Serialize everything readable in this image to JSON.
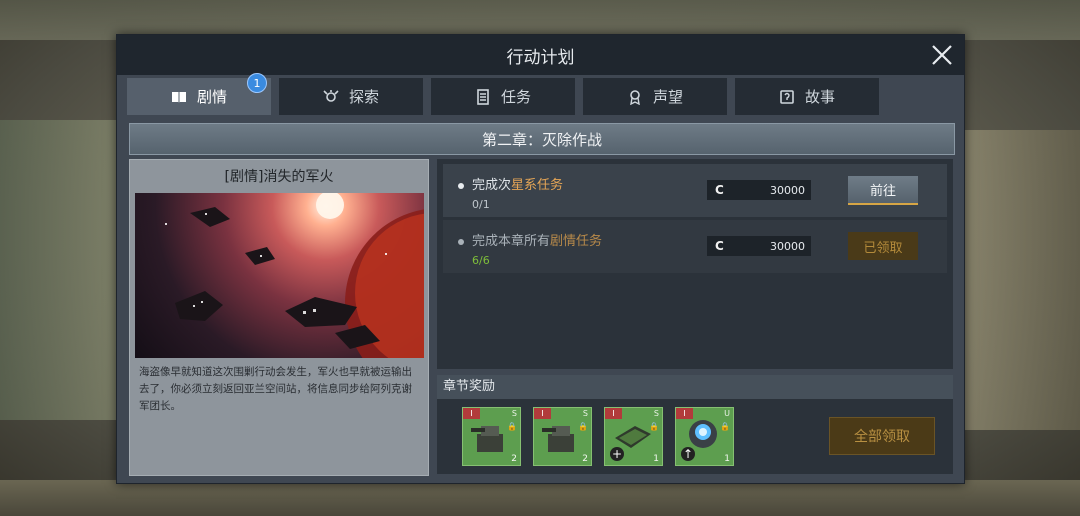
{
  "window": {
    "title": "行动计划"
  },
  "tabs": [
    {
      "label": "剧情",
      "icon": "book-icon",
      "active": true,
      "badge": "1"
    },
    {
      "label": "探索",
      "icon": "explore-icon",
      "active": false
    },
    {
      "label": "任务",
      "icon": "task-list-icon",
      "active": false
    },
    {
      "label": "声望",
      "icon": "medal-icon",
      "active": false
    },
    {
      "label": "故事",
      "icon": "story-icon",
      "active": false
    }
  ],
  "chapter": {
    "title": "第二章：灭除作战"
  },
  "story": {
    "title": "[剧情]消失的军火",
    "description": "海盗像早就知道这次围剿行动会发生，军火也早就被运输出去了，你必须立刻返回亚兰空间站，将信息同步给阿列克谢军团长。"
  },
  "tasks": [
    {
      "prefix": "完成",
      "middle": "次",
      "highlight": "星系任务",
      "progress": "0/1",
      "currency_icon": "C",
      "reward": "30000",
      "button": "前往"
    },
    {
      "prefix": "完成本章所有",
      "middle": "",
      "highlight": "剧情任务",
      "progress": "6/6",
      "currency_icon": "C",
      "reward": "30000",
      "button": "已领取"
    }
  ],
  "chapter_rewards": {
    "heading": "章节奖励",
    "items": [
      {
        "tag": "I",
        "grade": "S",
        "qty": "2",
        "icon": "turret-module-icon"
      },
      {
        "tag": "I",
        "grade": "S",
        "qty": "2",
        "icon": "turret-module-icon"
      },
      {
        "tag": "I",
        "grade": "S",
        "qty": "1",
        "icon": "circuit-board-icon"
      },
      {
        "tag": "I",
        "grade": "U",
        "qty": "1",
        "icon": "reactor-core-icon"
      }
    ],
    "claim_all_label": "全部领取"
  },
  "colors": {
    "highlight": "#e6a656",
    "progress_done": "#7fbf3a",
    "badge": "#3a8be0"
  }
}
